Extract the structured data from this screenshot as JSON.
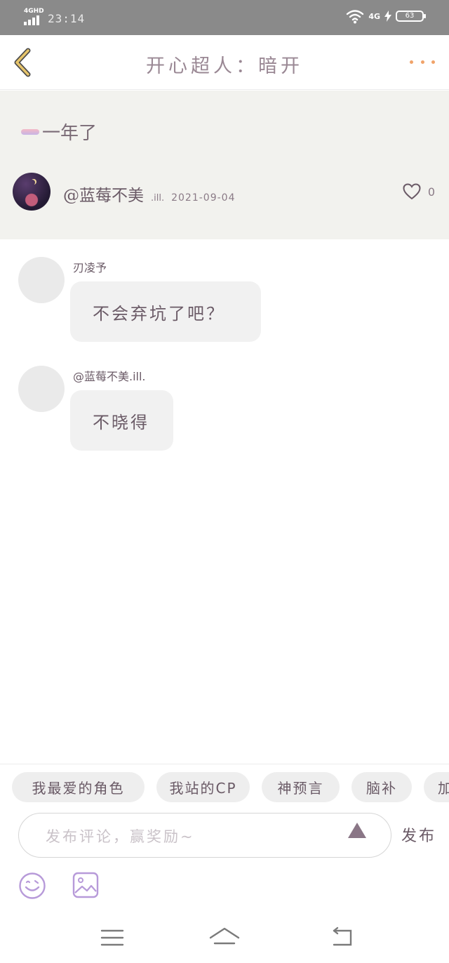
{
  "status_bar": {
    "network": "4GHD",
    "time": "23:14",
    "net_right": "4G",
    "battery": "63"
  },
  "header": {
    "title": "开心超人：暗开",
    "back_icon": "chevron-left-icon",
    "more_icon": "more-dots-icon"
  },
  "post": {
    "title": "一年了",
    "author": "@蓝莓不美",
    "author_suffix": ".ill.",
    "date": "2021-09-04",
    "like_count": "0"
  },
  "comments": [
    {
      "name": "刃凌予",
      "text": "不会弃坑了吧？"
    },
    {
      "name": "@蓝莓不美.ill.",
      "text": "不晓得"
    }
  ],
  "tags": [
    "我最爱的角色",
    "我站的CP",
    "神预言",
    "脑补",
    "加"
  ],
  "composer": {
    "placeholder": "发布评论，赢奖励~",
    "send_label": "发布"
  },
  "colors": {
    "accent": "#f0a36a",
    "back_icon": "#e6c46b",
    "status_bar": "#8a8a8a",
    "post_bg": "#f2f2ee"
  }
}
